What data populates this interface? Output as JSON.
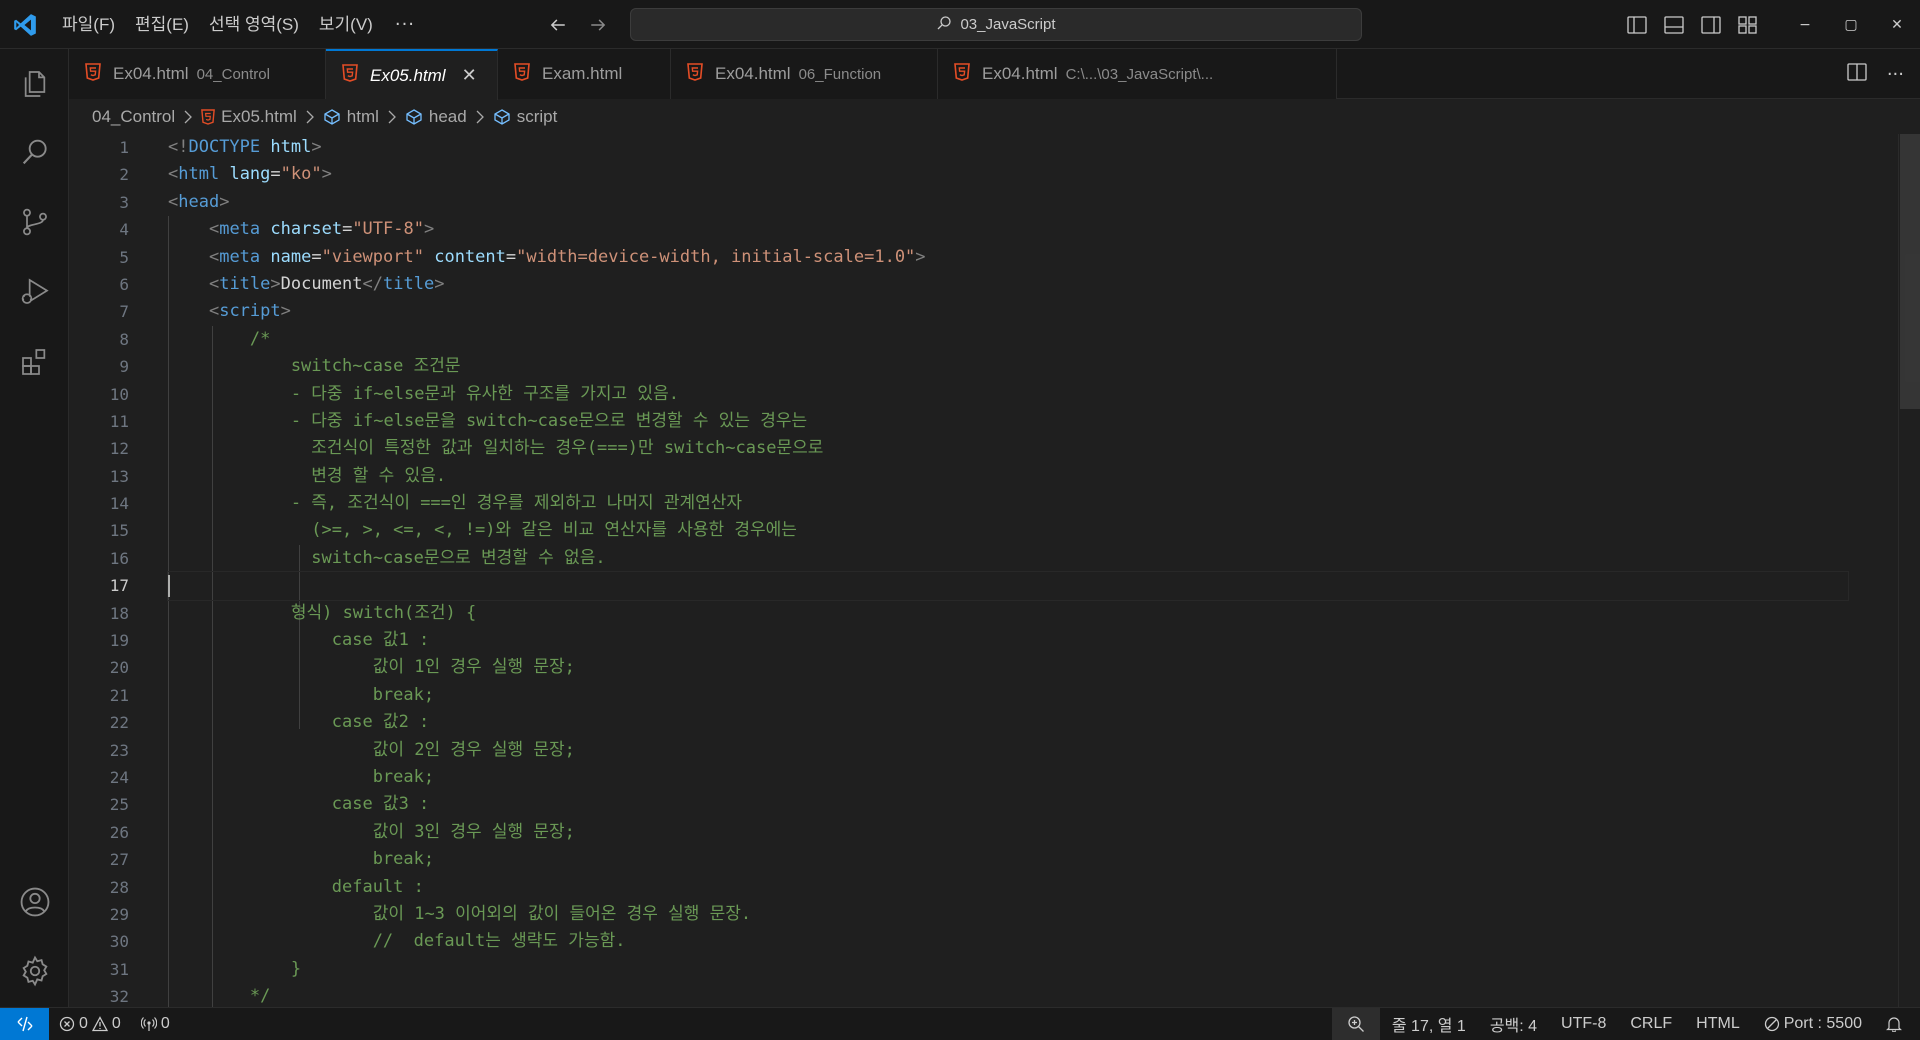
{
  "menu": [
    "파일(F)",
    "편집(E)",
    "선택 영역(S)",
    "보기(V)"
  ],
  "menu_more": "···",
  "command_center": "03_JavaScript",
  "window_controls": [
    "−",
    "▢",
    "✕"
  ],
  "tabs": [
    {
      "name": "Ex04.html",
      "desc": "04_Control",
      "active": false
    },
    {
      "name": "Ex05.html",
      "desc": "",
      "active": true,
      "close": "✕"
    },
    {
      "name": "Exam.html",
      "desc": "",
      "active": false
    },
    {
      "name": "Ex04.html",
      "desc": "06_Function",
      "active": false
    },
    {
      "name": "Ex04.html",
      "desc": "C:\\...\\03_JavaScript\\...",
      "active": false
    }
  ],
  "tab_more": "···",
  "breadcrumb": [
    "04_Control",
    "Ex05.html",
    "html",
    "head",
    "script"
  ],
  "editor": {
    "current_line": 17,
    "line_numbers": [
      "1",
      "2",
      "3",
      "4",
      "5",
      "6",
      "7",
      "8",
      "9",
      "10",
      "11",
      "12",
      "13",
      "14",
      "15",
      "16",
      "17",
      "18",
      "19",
      "20",
      "21",
      "22",
      "23",
      "24",
      "25",
      "26",
      "27",
      "28",
      "29",
      "30",
      "31",
      "32"
    ],
    "lines": [
      {
        "tokens": [
          [
            "tag-b",
            "<!"
          ],
          [
            "doctype",
            "DOCTYPE"
          ],
          [
            "txt",
            " "
          ],
          [
            "attr",
            "html"
          ],
          [
            "tag-b",
            ">"
          ]
        ]
      },
      {
        "tokens": [
          [
            "tag-b",
            "<"
          ],
          [
            "tag",
            "html"
          ],
          [
            "txt",
            " "
          ],
          [
            "attr",
            "lang"
          ],
          [
            "txt",
            "="
          ],
          [
            "str",
            "\"ko\""
          ],
          [
            "tag-b",
            ">"
          ]
        ]
      },
      {
        "tokens": [
          [
            "tag-b",
            "<"
          ],
          [
            "tag",
            "head"
          ],
          [
            "tag-b",
            ">"
          ]
        ]
      },
      {
        "tokens": [
          [
            "txt",
            "    "
          ],
          [
            "tag-b",
            "<"
          ],
          [
            "tag",
            "meta"
          ],
          [
            "txt",
            " "
          ],
          [
            "attr",
            "charset"
          ],
          [
            "txt",
            "="
          ],
          [
            "str",
            "\"UTF-8\""
          ],
          [
            "tag-b",
            ">"
          ]
        ]
      },
      {
        "tokens": [
          [
            "txt",
            "    "
          ],
          [
            "tag-b",
            "<"
          ],
          [
            "tag",
            "meta"
          ],
          [
            "txt",
            " "
          ],
          [
            "attr",
            "name"
          ],
          [
            "txt",
            "="
          ],
          [
            "str",
            "\"viewport\""
          ],
          [
            "txt",
            " "
          ],
          [
            "attr",
            "content"
          ],
          [
            "txt",
            "="
          ],
          [
            "str",
            "\"width=device-width, initial-scale=1.0\""
          ],
          [
            "tag-b",
            ">"
          ]
        ]
      },
      {
        "tokens": [
          [
            "txt",
            "    "
          ],
          [
            "tag-b",
            "<"
          ],
          [
            "tag",
            "title"
          ],
          [
            "tag-b",
            ">"
          ],
          [
            "txt",
            "Document"
          ],
          [
            "tag-b",
            "</"
          ],
          [
            "tag",
            "title"
          ],
          [
            "tag-b",
            ">"
          ]
        ]
      },
      {
        "tokens": [
          [
            "txt",
            "    "
          ],
          [
            "tag-b",
            "<"
          ],
          [
            "tag",
            "script"
          ],
          [
            "tag-b",
            ">"
          ]
        ]
      },
      {
        "tokens": [
          [
            "cmt",
            "        /*"
          ]
        ]
      },
      {
        "tokens": [
          [
            "cmt",
            "            switch~case 조건문"
          ]
        ]
      },
      {
        "tokens": [
          [
            "cmt",
            "            - 다중 if~else문과 유사한 구조를 가지고 있음."
          ]
        ]
      },
      {
        "tokens": [
          [
            "cmt",
            "            - 다중 if~else문을 switch~case문으로 변경할 수 있는 경우는"
          ]
        ]
      },
      {
        "tokens": [
          [
            "cmt",
            "              조건식이 특정한 값과 일치하는 경우(===)만 switch~case문으로"
          ]
        ]
      },
      {
        "tokens": [
          [
            "cmt",
            "              변경 할 수 있음."
          ]
        ]
      },
      {
        "tokens": [
          [
            "cmt",
            "            - 즉, 조건식이 ===인 경우를 제외하고 나머지 관계연산자"
          ]
        ]
      },
      {
        "tokens": [
          [
            "cmt",
            "              (>=, >, <=, <, !=)와 같은 비교 연산자를 사용한 경우에는"
          ]
        ]
      },
      {
        "tokens": [
          [
            "cmt",
            "              switch~case문으로 변경할 수 없음."
          ]
        ]
      },
      {
        "tokens": [
          [
            "cmt",
            ""
          ]
        ]
      },
      {
        "tokens": [
          [
            "cmt",
            "            형식) switch(조건) {"
          ]
        ]
      },
      {
        "tokens": [
          [
            "cmt",
            "                case 값1 :"
          ]
        ]
      },
      {
        "tokens": [
          [
            "cmt",
            "                    값이 1인 경우 실행 문장;"
          ]
        ]
      },
      {
        "tokens": [
          [
            "cmt",
            "                    break;"
          ]
        ]
      },
      {
        "tokens": [
          [
            "cmt",
            "                case 값2 :"
          ]
        ]
      },
      {
        "tokens": [
          [
            "cmt",
            "                    값이 2인 경우 실행 문장;"
          ]
        ]
      },
      {
        "tokens": [
          [
            "cmt",
            "                    break;"
          ]
        ]
      },
      {
        "tokens": [
          [
            "cmt",
            "                case 값3 :"
          ]
        ]
      },
      {
        "tokens": [
          [
            "cmt",
            "                    값이 3인 경우 실행 문장;"
          ]
        ]
      },
      {
        "tokens": [
          [
            "cmt",
            "                    break;"
          ]
        ]
      },
      {
        "tokens": [
          [
            "cmt",
            "                default :"
          ]
        ]
      },
      {
        "tokens": [
          [
            "cmt",
            "                    값이 1~3 이어외의 값이 들어온 경우 실행 문장."
          ]
        ]
      },
      {
        "tokens": [
          [
            "cmt",
            "                    //  default는 생략도 가능함."
          ]
        ]
      },
      {
        "tokens": [
          [
            "cmt",
            "            }"
          ]
        ]
      },
      {
        "tokens": [
          [
            "cmt",
            "        */"
          ]
        ]
      }
    ]
  },
  "status": {
    "errors": "0",
    "warnings": "0",
    "ports": "0",
    "cursor_pos": "줄 17, 열 1",
    "indent": "공백: 4",
    "encoding": "UTF-8",
    "eol": "CRLF",
    "language": "HTML",
    "port": "Port : 5500"
  },
  "colors": {
    "accent": "#0078d4",
    "html5_icon": "#e44d26",
    "comment": "#6a9955",
    "tag": "#569cd6",
    "attr": "#9cdcfe",
    "string": "#ce9178"
  }
}
